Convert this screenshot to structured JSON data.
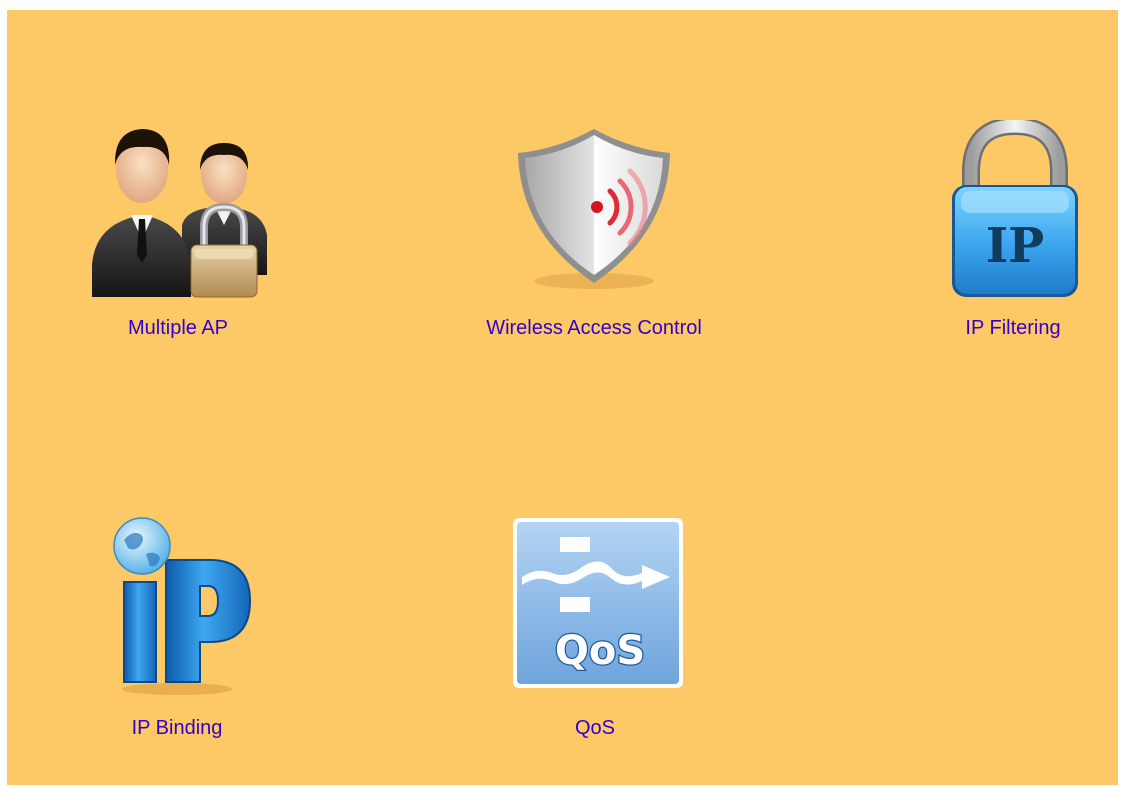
{
  "panel": {
    "background": "#fdc866"
  },
  "items": [
    {
      "label": "Multiple AP",
      "icon": "users-lock-icon"
    },
    {
      "label": "Wireless Access Control",
      "icon": "shield-wireless-icon"
    },
    {
      "label": "IP Filtering",
      "icon": "ip-padlock-icon"
    },
    {
      "label": "IP Binding",
      "icon": "ip-globe-icon"
    },
    {
      "label": "QoS",
      "icon": "qos-icon"
    }
  ],
  "colors": {
    "label": "#3300cc"
  }
}
